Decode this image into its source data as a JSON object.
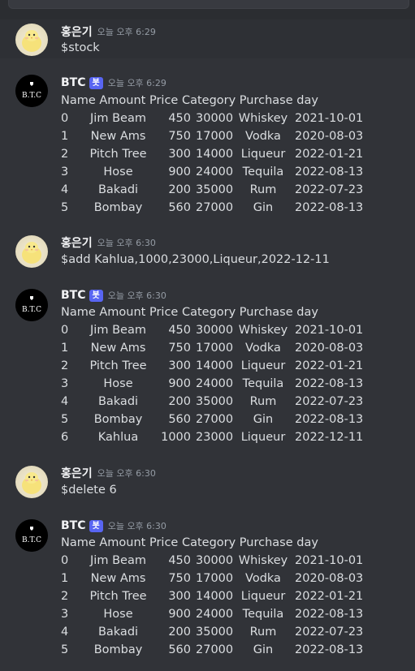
{
  "messages": [
    {
      "author": "홍은기",
      "is_bot": false,
      "timestamp": "오늘 오후 6:29",
      "text": "$stock"
    },
    {
      "author": "BTC",
      "is_bot": true,
      "bot_tag": "봇",
      "timestamp": "오늘 오후 6:29",
      "avatar_text": "B.T.C",
      "table_header": "Name  Amount  Price Category Purchase day",
      "rows": [
        [
          "0",
          "Jim Beam",
          "450",
          "30000",
          "Whiskey",
          "2021-10-01"
        ],
        [
          "1",
          "New Ams",
          "750",
          "17000",
          "Vodka",
          "2020-08-03"
        ],
        [
          "2",
          "Pitch Tree",
          "300",
          "14000",
          "Liqueur",
          "2022-01-21"
        ],
        [
          "3",
          "Hose",
          "900",
          "24000",
          "Tequila",
          "2022-08-13"
        ],
        [
          "4",
          "Bakadi",
          "200",
          "35000",
          "Rum",
          "2022-07-23"
        ],
        [
          "5",
          "Bombay",
          "560",
          "27000",
          "Gin",
          "2022-08-13"
        ]
      ]
    },
    {
      "author": "홍은기",
      "is_bot": false,
      "timestamp": "오늘 오후 6:30",
      "text": "$add Kahlua,1000,23000,Liqueur,2022-12-11"
    },
    {
      "author": "BTC",
      "is_bot": true,
      "bot_tag": "봇",
      "timestamp": "오늘 오후 6:30",
      "avatar_text": "B.T.C",
      "table_header": "Name  Amount  Price Category Purchase day",
      "rows": [
        [
          "0",
          "Jim Beam",
          "450",
          "30000",
          "Whiskey",
          "2021-10-01"
        ],
        [
          "1",
          "New Ams",
          "750",
          "17000",
          "Vodka",
          "2020-08-03"
        ],
        [
          "2",
          "Pitch Tree",
          "300",
          "14000",
          "Liqueur",
          "2022-01-21"
        ],
        [
          "3",
          "Hose",
          "900",
          "24000",
          "Tequila",
          "2022-08-13"
        ],
        [
          "4",
          "Bakadi",
          "200",
          "35000",
          "Rum",
          "2022-07-23"
        ],
        [
          "5",
          "Bombay",
          "560",
          "27000",
          "Gin",
          "2022-08-13"
        ],
        [
          "6",
          "Kahlua",
          "1000",
          "23000",
          "Liqueur",
          "2022-12-11"
        ]
      ]
    },
    {
      "author": "홍은기",
      "is_bot": false,
      "timestamp": "오늘 오후 6:30",
      "text": "$delete 6"
    },
    {
      "author": "BTC",
      "is_bot": true,
      "bot_tag": "봇",
      "timestamp": "오늘 오후 6:30",
      "avatar_text": "B.T.C",
      "table_header": "Name  Amount  Price Category Purchase day",
      "rows": [
        [
          "0",
          "Jim Beam",
          "450",
          "30000",
          "Whiskey",
          "2021-10-01"
        ],
        [
          "1",
          "New Ams",
          "750",
          "17000",
          "Vodka",
          "2020-08-03"
        ],
        [
          "2",
          "Pitch Tree",
          "300",
          "14000",
          "Liqueur",
          "2022-01-21"
        ],
        [
          "3",
          "Hose",
          "900",
          "24000",
          "Tequila",
          "2022-08-13"
        ],
        [
          "4",
          "Bakadi",
          "200",
          "35000",
          "Rum",
          "2022-07-23"
        ],
        [
          "5",
          "Bombay",
          "560",
          "27000",
          "Gin",
          "2022-08-13"
        ]
      ]
    }
  ]
}
